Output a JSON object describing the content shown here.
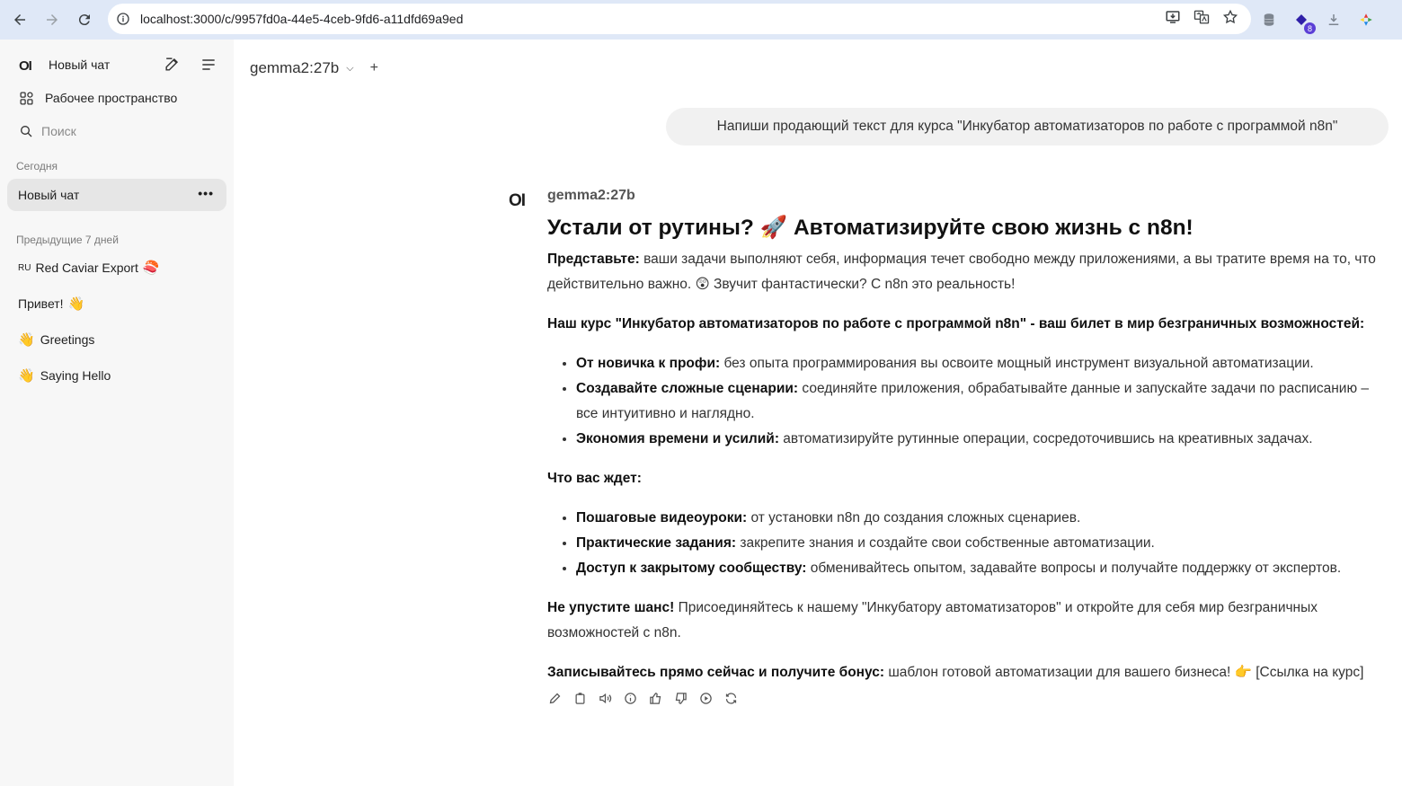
{
  "browser": {
    "url": "localhost:3000/c/9957fd0a-44e5-4ceb-9fd6-a11dfd69a9ed",
    "extension_badge": "8"
  },
  "sidebar": {
    "logo": "OI",
    "new_chat": "Новый чат",
    "workspace": "Рабочее пространство",
    "search_placeholder": "Поиск",
    "section_today": "Сегодня",
    "active_chat": "Новый чат",
    "active_chat_menu": "•••",
    "section_prev7": "Предыдущие 7 дней",
    "chats": [
      {
        "prefix": "RU",
        "label": "Red Caviar Export",
        "emoji": "🍣"
      },
      {
        "prefix": "",
        "label": "Привет!",
        "emoji": "👋"
      },
      {
        "prefix": "👋",
        "label": "Greetings",
        "emoji": ""
      },
      {
        "prefix": "👋",
        "label": "Saying Hello",
        "emoji": ""
      }
    ]
  },
  "main": {
    "model": "gemma2:27b",
    "user_message": "Напиши продающий текст для курса \"Инкубатор автоматизаторов по работе с программой n8n\"",
    "assistant": {
      "logo": "OI",
      "name": "gemma2:27b",
      "title": "Устали от рутины? 🚀 Автоматизируйте свою жизнь с n8n!",
      "p1_bold": "Представьте:",
      "p1_text": " ваши задачи выполняют себя, информация течет свободно между приложениями, а вы тратите время на то, что действительно важно. 😲 Звучит фантастически? С n8n это реальность!",
      "p2_bold": "Наш курс \"Инкубатор автоматизаторов по работе с программой n8n\" - ваш билет в мир безграничных возможностей:",
      "list1": [
        {
          "bold": "От новичка к профи:",
          "text": " без опыта программирования вы освоите мощный инструмент визуальной автоматизации."
        },
        {
          "bold": "Создавайте сложные сценарии:",
          "text": " соединяйте приложения, обрабатывайте данные и запускайте задачи по расписанию – все интуитивно и наглядно."
        },
        {
          "bold": "Экономия времени и усилий:",
          "text": " автоматизируйте рутинные операции, сосредоточившись на креативных задачах."
        }
      ],
      "p3_bold": "Что вас ждет:",
      "list2": [
        {
          "bold": "Пошаговые видеоуроки:",
          "text": " от установки n8n до создания сложных сценариев."
        },
        {
          "bold": "Практические задания:",
          "text": " закрепите знания и создайте свои собственные автоматизации."
        },
        {
          "bold": "Доступ к закрытому сообществу:",
          "text": " обменивайтесь опытом, задавайте вопросы и получайте поддержку от экспертов."
        }
      ],
      "p4_bold": "Не упустите шанс!",
      "p4_text": " Присоединяйтесь к нашему \"Инкубатору автоматизаторов\" и откройте для себя мир безграничных возможностей с n8n.",
      "p5_bold": "Записывайтесь прямо сейчас и получите бонус:",
      "p5_text": " шаблон готовой автоматизации для вашего бизнеса! 👉 [Ссылка на курс]"
    }
  }
}
